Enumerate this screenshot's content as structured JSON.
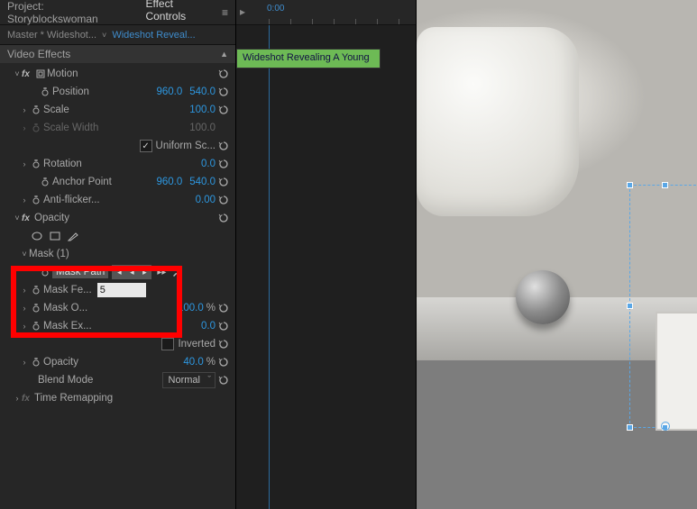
{
  "header": {
    "project_label": "Project: Storyblockswoman",
    "tab_active": "Effect Controls"
  },
  "selector": {
    "master": "Master * Wideshot...",
    "clip": "Wideshot Reveal..."
  },
  "section_header": "Video Effects",
  "motion": {
    "label": "Motion",
    "position": {
      "label": "Position",
      "x": "960.0",
      "y": "540.0"
    },
    "scale": {
      "label": "Scale",
      "value": "100.0"
    },
    "scale_width": {
      "label": "Scale Width",
      "value": "100.0",
      "enabled": false
    },
    "uniform": {
      "label": "Uniform Sc...",
      "checked": true
    },
    "rotation": {
      "label": "Rotation",
      "value": "0.0"
    },
    "anchor": {
      "label": "Anchor Point",
      "x": "960.0",
      "y": "540.0"
    },
    "antiflicker": {
      "label": "Anti-flicker...",
      "value": "0.00"
    }
  },
  "opacity": {
    "label": "Opacity",
    "mask": {
      "label": "Mask (1)",
      "path": "Mask Path",
      "feather": {
        "label": "Mask Fe...",
        "value": "5"
      },
      "opacity": {
        "label": "Mask O...",
        "value": "100.0",
        "unit": "%"
      },
      "expansion": {
        "label": "Mask Ex...",
        "value": "0.0"
      },
      "inverted": {
        "label": "Inverted",
        "checked": false
      }
    },
    "value": {
      "label": "Opacity",
      "value": "40.0",
      "unit": "%"
    },
    "blend": {
      "label": "Blend Mode",
      "value": "Normal"
    }
  },
  "time_remapping": "Time Remapping",
  "timeline": {
    "playhead": "0:00",
    "clip_label": "Wideshot Revealing A Young"
  }
}
